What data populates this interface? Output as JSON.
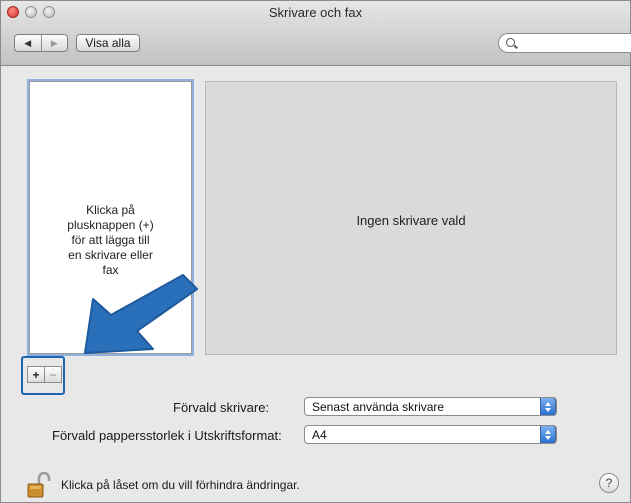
{
  "window": {
    "title": "Skrivare och fax"
  },
  "toolbar": {
    "back_icon": "◀",
    "forward_icon": "▶",
    "show_all_label": "Visa alla",
    "search_placeholder": ""
  },
  "printer_list": {
    "hint_lines": [
      "Klicka på",
      "plusknappen (+)",
      "för att lägga till",
      "en skrivare eller",
      "fax"
    ],
    "add_label": "+",
    "remove_label": "−"
  },
  "detail": {
    "empty_text": "Ingen skrivare vald"
  },
  "settings": {
    "default_printer_label": "Förvald skrivare:",
    "default_printer_value": "Senast använda skrivare",
    "paper_size_label": "Förvald pappersstorlek i Utskriftsformat:",
    "paper_size_value": "A4"
  },
  "footer": {
    "lock_text": "Klicka på låset om du vill förhindra ändringar.",
    "help_label": "?"
  },
  "colors": {
    "highlight": "#1f63b4",
    "arrow": "#2a6fba"
  }
}
